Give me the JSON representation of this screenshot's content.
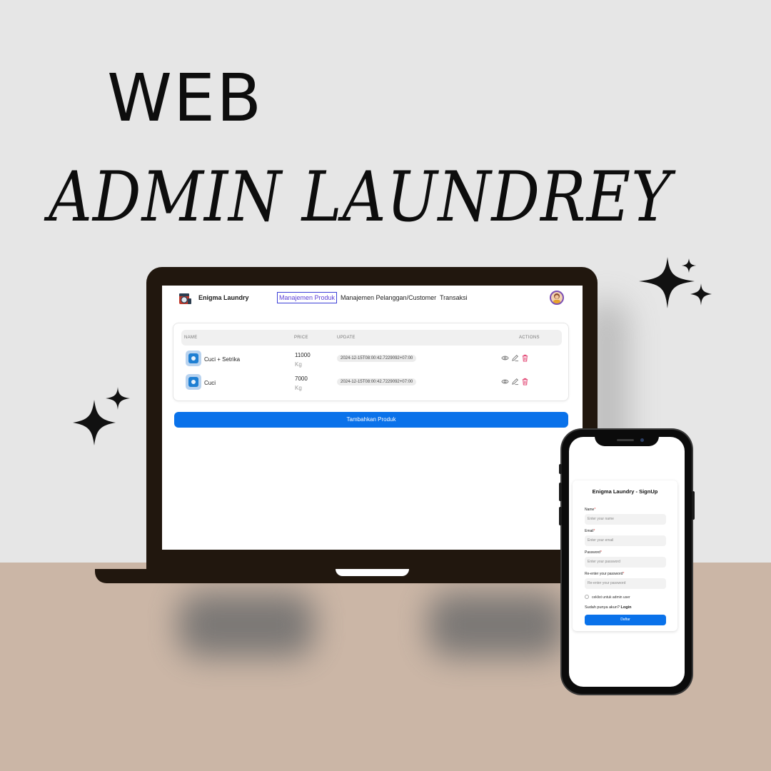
{
  "poster": {
    "title_line1": "WEB",
    "title_line2": "ADMIN LAUNDREY"
  },
  "desktop_app": {
    "brand": "Enigma Laundry",
    "nav": [
      {
        "label": "Manajemen Produk",
        "active": true
      },
      {
        "label": "Manajemen Pelanggan/Customer",
        "active": false
      },
      {
        "label": "Transaksi",
        "active": false
      }
    ],
    "table": {
      "headers": {
        "name": "NAME",
        "price": "PRICE",
        "update": "UPDATE",
        "actions": "ACTIONS"
      },
      "rows": [
        {
          "name": "Cuci + Setrika",
          "price": "11000",
          "unit": "Kg",
          "update": "2024-12-15T08:00:42.7229092+07:00"
        },
        {
          "name": "Cuci",
          "price": "7000",
          "unit": "Kg",
          "update": "2024-12-15T08:00:42.7229092+07:00"
        }
      ],
      "action_icons": [
        "eye-icon",
        "edit-icon",
        "trash-icon"
      ]
    },
    "add_button": "Tambahkan Produk"
  },
  "mobile_app": {
    "title": "Enigma Laundry - SignUp",
    "fields": [
      {
        "label": "Name",
        "placeholder": "Enter your name"
      },
      {
        "label": "Email",
        "placeholder": "Enter your email"
      },
      {
        "label": "Password",
        "placeholder": "Enter your password"
      },
      {
        "label": "Re-enter your password",
        "placeholder": "Re-enter your password"
      }
    ],
    "required_mark": "*",
    "checkbox_label": "ceklist untuk admin user",
    "login_prompt": "Sudah punya akun?",
    "login_link": "Login",
    "submit_label": "Daftar"
  },
  "colors": {
    "accent": "#0a72ea",
    "active_nav": "#5b3fd6",
    "delete": "#e03a6a",
    "laptop_frame": "#21170e",
    "floor": "#cbb6a6",
    "backdrop": "#e6e6e6"
  }
}
